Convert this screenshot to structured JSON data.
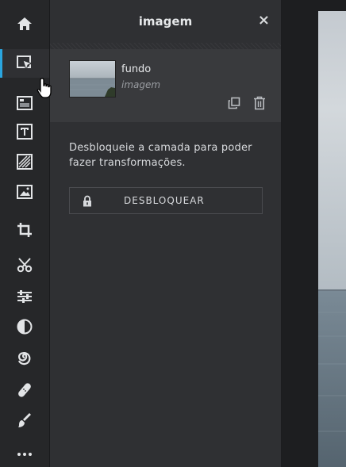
{
  "toolbar": {
    "tools": [
      "home-icon",
      "select-arrange-icon",
      "layers-grid-icon",
      "text-icon",
      "texture-icon",
      "image-icon",
      "crop-icon",
      "cut-icon",
      "adjust-sliders-icon",
      "contrast-icon",
      "spiral-icon",
      "bandage-icon",
      "brush-icon",
      "more-icon"
    ],
    "active_tool": "select-arrange-icon",
    "accent": "#2aa6e0"
  },
  "panel": {
    "title": "imagem",
    "close_label": "×",
    "layer": {
      "name": "fundo",
      "type": "imagem"
    },
    "message": "Desbloqueie a camada para poder fazer transformações.",
    "unlock_label": "DESBLOQUEAR"
  }
}
